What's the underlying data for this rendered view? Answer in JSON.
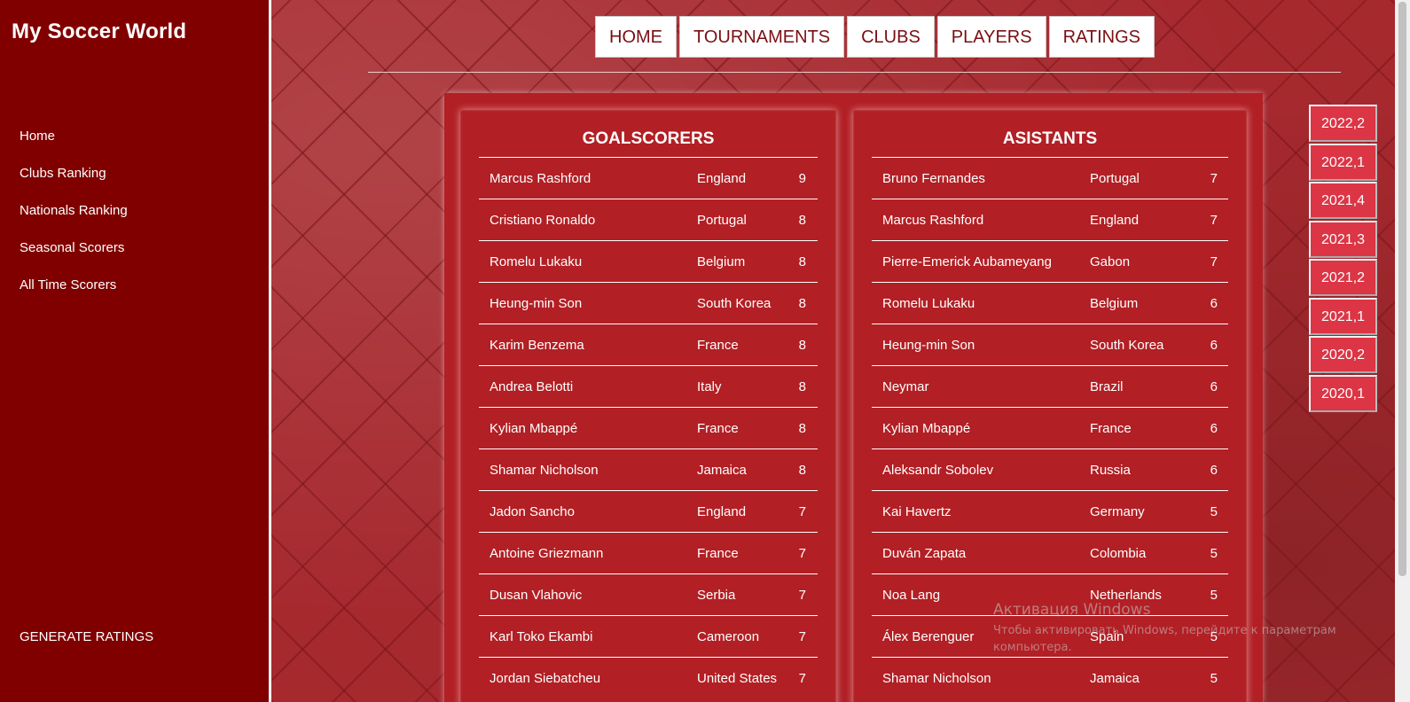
{
  "app": {
    "brand": "My Soccer World"
  },
  "sidebar": {
    "items": [
      {
        "label": "Home"
      },
      {
        "label": "Clubs Ranking"
      },
      {
        "label": "Nationals Ranking"
      },
      {
        "label": "Seasonal Scorers"
      },
      {
        "label": "All Time Scorers"
      }
    ],
    "generate_label": "GENERATE RATINGS"
  },
  "top_nav": {
    "items": [
      {
        "label": "HOME"
      },
      {
        "label": "TOURNAMENTS"
      },
      {
        "label": "CLUBS"
      },
      {
        "label": "PLAYERS"
      },
      {
        "label": "RATINGS"
      }
    ]
  },
  "goalscorers": {
    "title": "GOALSCORERS",
    "rows": [
      {
        "name": "Marcus Rashford",
        "country": "England",
        "value": "9"
      },
      {
        "name": "Cristiano Ronaldo",
        "country": "Portugal",
        "value": "8"
      },
      {
        "name": "Romelu Lukaku",
        "country": "Belgium",
        "value": "8"
      },
      {
        "name": "Heung-min Son",
        "country": "South Korea",
        "value": "8"
      },
      {
        "name": "Karim Benzema",
        "country": "France",
        "value": "8"
      },
      {
        "name": "Andrea Belotti",
        "country": "Italy",
        "value": "8"
      },
      {
        "name": "Kylian Mbappé",
        "country": "France",
        "value": "8"
      },
      {
        "name": "Shamar Nicholson",
        "country": "Jamaica",
        "value": "8"
      },
      {
        "name": "Jadon Sancho",
        "country": "England",
        "value": "7"
      },
      {
        "name": "Antoine Griezmann",
        "country": "France",
        "value": "7"
      },
      {
        "name": "Dusan Vlahovic",
        "country": "Serbia",
        "value": "7"
      },
      {
        "name": "Karl Toko Ekambi",
        "country": "Cameroon",
        "value": "7"
      },
      {
        "name": "Jordan Siebatcheu",
        "country": "United States",
        "value": "7"
      }
    ]
  },
  "assistants": {
    "title": "ASISTANTS",
    "rows": [
      {
        "name": "Bruno Fernandes",
        "country": "Portugal",
        "value": "7"
      },
      {
        "name": "Marcus Rashford",
        "country": "England",
        "value": "7"
      },
      {
        "name": "Pierre-Emerick Aubameyang",
        "country": "Gabon",
        "value": "7"
      },
      {
        "name": "Romelu Lukaku",
        "country": "Belgium",
        "value": "6"
      },
      {
        "name": "Heung-min Son",
        "country": "South Korea",
        "value": "6"
      },
      {
        "name": "Neymar",
        "country": "Brazil",
        "value": "6"
      },
      {
        "name": "Kylian Mbappé",
        "country": "France",
        "value": "6"
      },
      {
        "name": "Aleksandr Sobolev",
        "country": "Russia",
        "value": "6"
      },
      {
        "name": "Kai Havertz",
        "country": "Germany",
        "value": "5"
      },
      {
        "name": "Duván Zapata",
        "country": "Colombia",
        "value": "5"
      },
      {
        "name": "Noa Lang",
        "country": "Netherlands",
        "value": "5"
      },
      {
        "name": "Álex Berenguer",
        "country": "Spain",
        "value": "5"
      },
      {
        "name": "Shamar Nicholson",
        "country": "Jamaica",
        "value": "5"
      }
    ]
  },
  "seasons": [
    "2022,2",
    "2022,1",
    "2021,4",
    "2021,3",
    "2021,2",
    "2021,1",
    "2020,2",
    "2020,1"
  ],
  "watermark": {
    "title": "Активация Windows",
    "subtitle": "Чтобы активировать Windows, перейдите к параметрам компьютера."
  },
  "colors": {
    "sidebar_bg": "#800000",
    "panel_bg": "#b21f24",
    "season_btn_bg": "#dc3545",
    "nav_text": "#7a0f13"
  }
}
